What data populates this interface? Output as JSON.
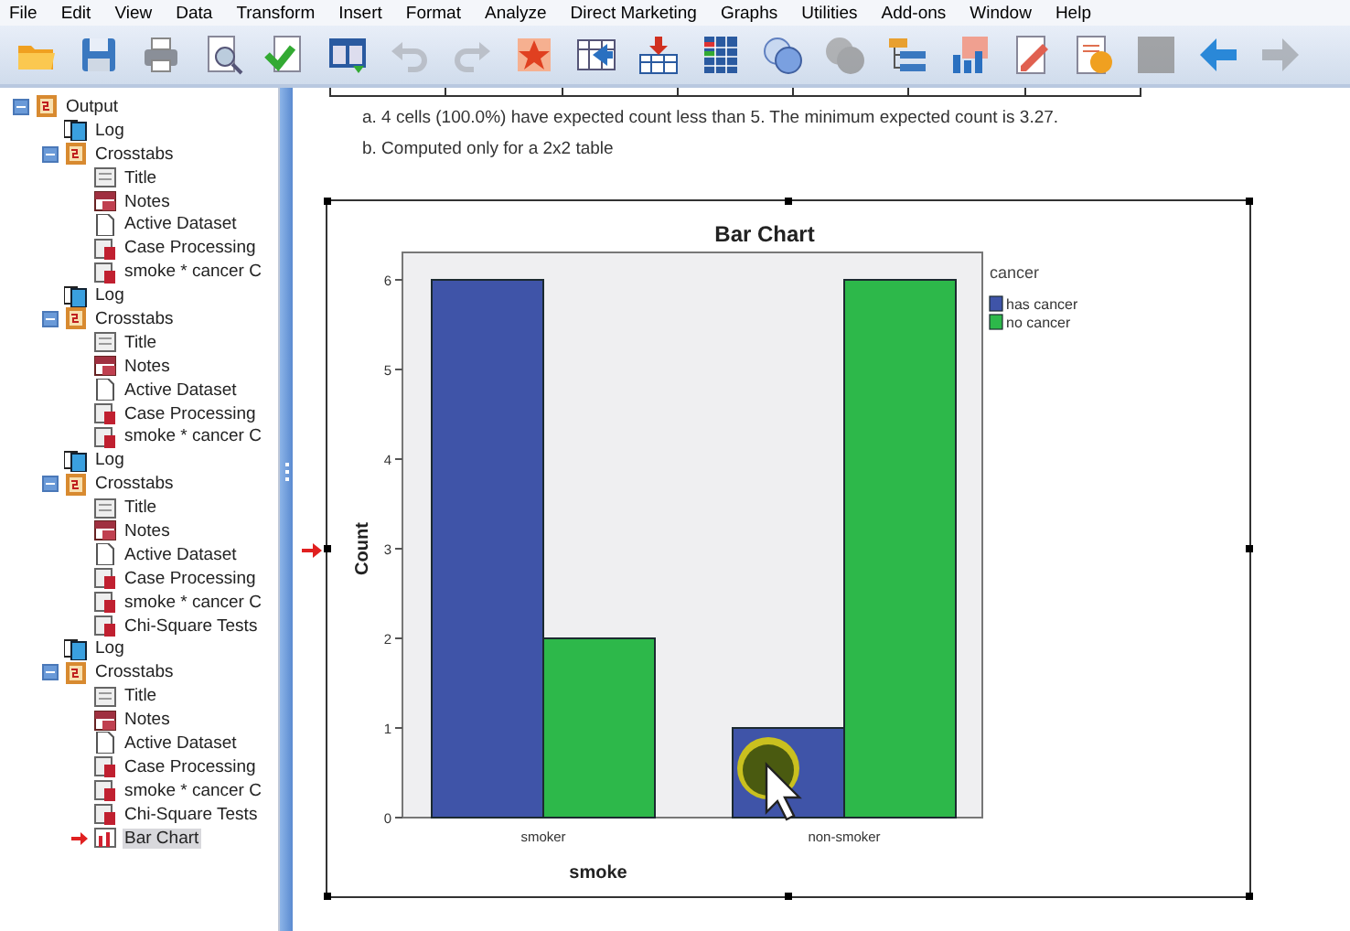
{
  "menu": [
    "File",
    "Edit",
    "View",
    "Data",
    "Transform",
    "Insert",
    "Format",
    "Analyze",
    "Direct Marketing",
    "Graphs",
    "Utilities",
    "Add-ons",
    "Window",
    "Help"
  ],
  "toolbar": [
    {
      "kind": "open",
      "disabled": false
    },
    {
      "kind": "save",
      "disabled": false
    },
    {
      "kind": "print",
      "disabled": false
    },
    {
      "kind": "preview",
      "disabled": false
    },
    {
      "kind": "export",
      "disabled": false
    },
    {
      "kind": "dialog",
      "disabled": false
    },
    {
      "kind": "undo",
      "disabled": true
    },
    {
      "kind": "redo",
      "disabled": true
    },
    {
      "kind": "star",
      "disabled": false
    },
    {
      "kind": "goto",
      "disabled": false
    },
    {
      "kind": "insert",
      "disabled": false
    },
    {
      "kind": "grid",
      "disabled": false
    },
    {
      "kind": "circles",
      "disabled": false
    },
    {
      "kind": "circles",
      "disabled": true
    },
    {
      "kind": "tree",
      "disabled": false
    },
    {
      "kind": "chart",
      "disabled": false
    },
    {
      "kind": "edit",
      "disabled": false
    },
    {
      "kind": "script",
      "disabled": false
    },
    {
      "kind": "square",
      "disabled": true
    },
    {
      "kind": "back",
      "disabled": false
    },
    {
      "kind": "forward",
      "disabled": true
    }
  ],
  "tree": {
    "label": "Output",
    "kind": "output",
    "expanded": true,
    "selected": false,
    "children": [
      {
        "label": "Log",
        "kind": "log",
        "selected": false
      },
      {
        "label": "Crosstabs",
        "kind": "crosstabs",
        "expanded": true,
        "selected": false,
        "children": [
          {
            "label": "Title",
            "kind": "title",
            "selected": false
          },
          {
            "label": "Notes",
            "kind": "notes",
            "selected": false
          },
          {
            "label": "Active Dataset",
            "kind": "page",
            "selected": false
          },
          {
            "label": "Case Processing",
            "kind": "table",
            "selected": false
          },
          {
            "label": "smoke * cancer C",
            "kind": "table",
            "selected": false
          }
        ]
      },
      {
        "label": "Log",
        "kind": "log",
        "selected": false
      },
      {
        "label": "Crosstabs",
        "kind": "crosstabs",
        "expanded": true,
        "selected": false,
        "children": [
          {
            "label": "Title",
            "kind": "title",
            "selected": false
          },
          {
            "label": "Notes",
            "kind": "notes",
            "selected": false
          },
          {
            "label": "Active Dataset",
            "kind": "page",
            "selected": false
          },
          {
            "label": "Case Processing",
            "kind": "table",
            "selected": false
          },
          {
            "label": "smoke * cancer C",
            "kind": "table",
            "selected": false
          }
        ]
      },
      {
        "label": "Log",
        "kind": "log",
        "selected": false
      },
      {
        "label": "Crosstabs",
        "kind": "crosstabs",
        "expanded": true,
        "selected": false,
        "children": [
          {
            "label": "Title",
            "kind": "title",
            "selected": false
          },
          {
            "label": "Notes",
            "kind": "notes",
            "selected": false
          },
          {
            "label": "Active Dataset",
            "kind": "page",
            "selected": false
          },
          {
            "label": "Case Processing",
            "kind": "table",
            "selected": false
          },
          {
            "label": "smoke * cancer C",
            "kind": "table",
            "selected": false
          },
          {
            "label": "Chi-Square Tests",
            "kind": "table",
            "selected": false
          }
        ]
      },
      {
        "label": "Log",
        "kind": "log",
        "selected": false
      },
      {
        "label": "Crosstabs",
        "kind": "crosstabs",
        "expanded": true,
        "selected": false,
        "children": [
          {
            "label": "Title",
            "kind": "title",
            "selected": false
          },
          {
            "label": "Notes",
            "kind": "notes",
            "selected": false
          },
          {
            "label": "Active Dataset",
            "kind": "page",
            "selected": false
          },
          {
            "label": "Case Processing",
            "kind": "table",
            "selected": false
          },
          {
            "label": "smoke * cancer C",
            "kind": "table",
            "selected": false
          },
          {
            "label": "Chi-Square Tests",
            "kind": "table",
            "selected": false
          },
          {
            "label": "Bar Chart",
            "kind": "chart",
            "selected": true
          }
        ]
      }
    ]
  },
  "footnotes": [
    "a. 4 cells (100.0%) have expected count less than 5. The minimum expected count is 3.27.",
    "b. Computed only for a 2x2 table"
  ],
  "chart": {
    "chart_data": {
      "type": "bar",
      "title": "Bar Chart",
      "xlabel": "smoke",
      "ylabel": "Count",
      "categories": [
        "smoker",
        "non-smoker"
      ],
      "legend": {
        "title": "cancer"
      },
      "series": [
        {
          "name": "has cancer",
          "color": "#3f54a8",
          "values": [
            6,
            1
          ]
        },
        {
          "name": "no cancer",
          "color": "#2db84a",
          "values": [
            2,
            6
          ]
        }
      ],
      "ylim": [
        0,
        6
      ],
      "yticks": [
        0,
        1,
        2,
        3,
        4,
        5,
        6
      ]
    }
  }
}
